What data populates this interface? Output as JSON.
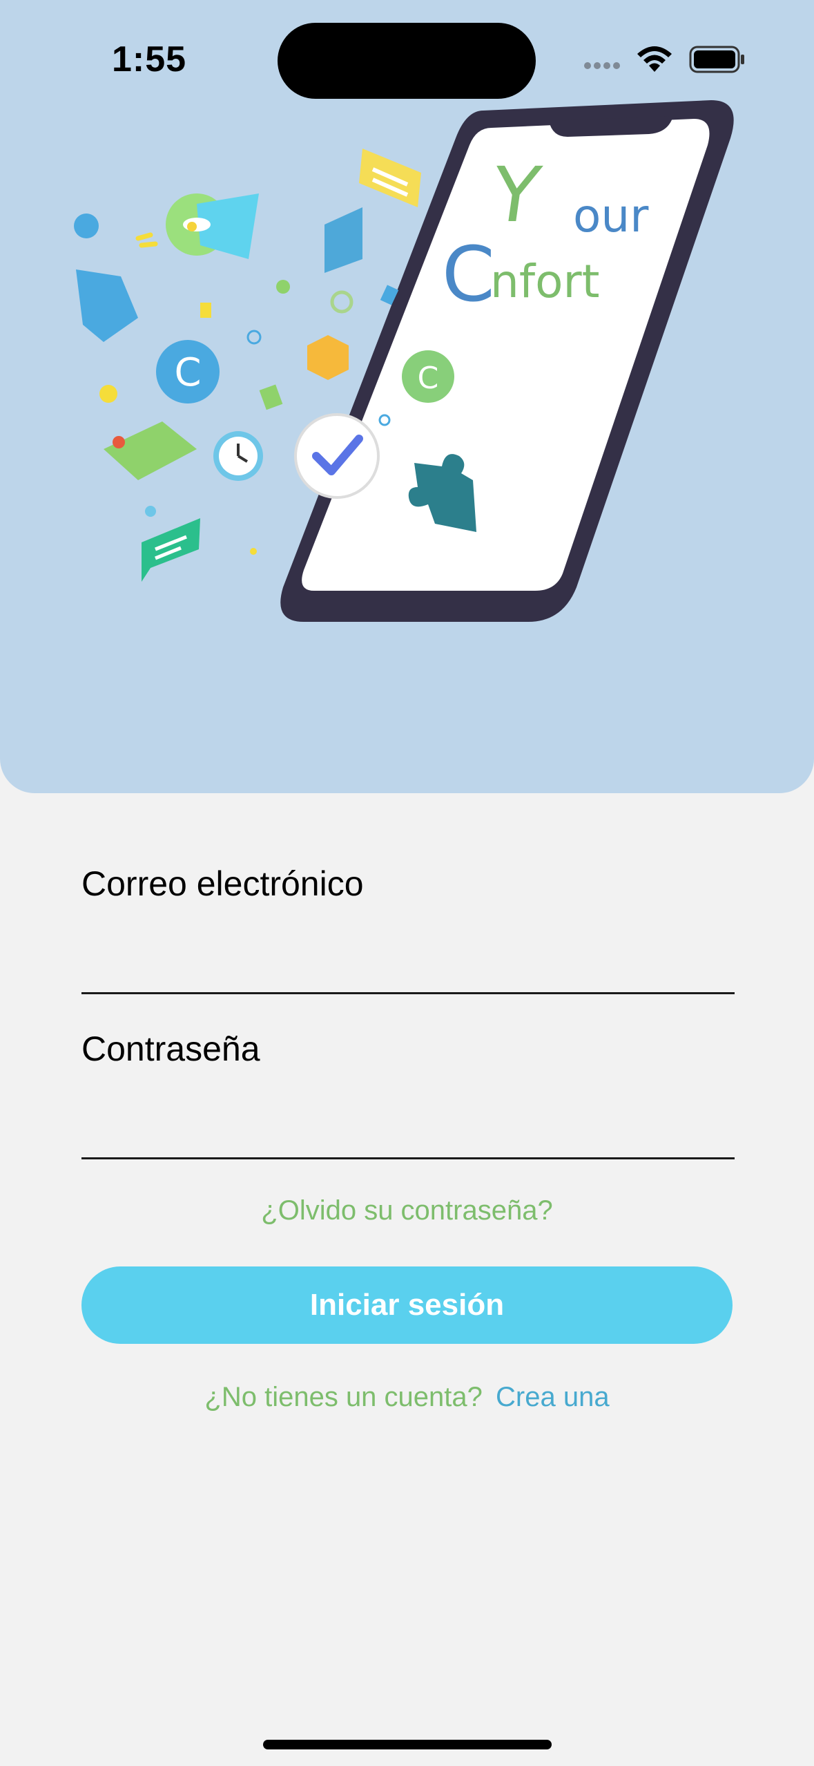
{
  "status_bar": {
    "time": "1:55"
  },
  "hero": {
    "logo_line1": "our",
    "logo_line2": "nfort",
    "logo_initial1": "Y",
    "logo_initial2": "C",
    "colors": {
      "background": "#bdd5ea",
      "logo_green": "#7dbd6c",
      "logo_blue": "#4a88c7"
    }
  },
  "form": {
    "email_label": "Correo electrónico",
    "email_value": "",
    "password_label": "Contraseña",
    "password_value": "",
    "forgot_password": "¿Olvido su contraseña?",
    "login_button": "Iniciar sesión",
    "signup_prompt": "¿No tienes un cuenta?",
    "signup_link": "Crea una"
  },
  "colors": {
    "accent_button": "#5ad0ee",
    "green_text": "#7dbd6c",
    "link_blue": "#47a9cf",
    "page_background": "#f2f2f2"
  }
}
